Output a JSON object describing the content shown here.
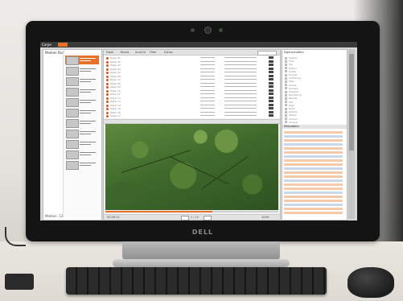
{
  "monitor": {
    "brand": "DELL"
  },
  "app": {
    "title": "Carpe",
    "badge_color": "#e8712a"
  },
  "left_panel": {
    "header": "Medien Pool",
    "footer": "Medien: 12",
    "thumbnails": [
      {
        "selected": true
      },
      {
        "selected": false
      },
      {
        "selected": false
      },
      {
        "selected": false
      },
      {
        "selected": false
      },
      {
        "selected": false
      },
      {
        "selected": false
      },
      {
        "selected": false
      },
      {
        "selected": false
      },
      {
        "selected": false
      },
      {
        "selected": false
      }
    ]
  },
  "center": {
    "toolbar": [
      "Datei",
      "Bearb.",
      "Ansicht",
      "Filter",
      "Extras"
    ],
    "rows": [
      "Datei 01",
      "Datei 02",
      "Datei 03",
      "Datei 04",
      "Datei 05",
      "Datei 06",
      "Datei 07",
      "Datei 08",
      "Datei 09",
      "Datei 10",
      "Datei 11",
      "Datei 12",
      "Datei 13",
      "Datei 14",
      "Datei 15",
      "Datei 16",
      "Datei 17"
    ],
    "preview_progress": 0.62,
    "footer": {
      "left": "00:00:12",
      "mid": "1 / 12",
      "right": "100%"
    }
  },
  "right_panel": {
    "header": "Eigenschaften",
    "lines": [
      "Objekt",
      "Titel",
      "Typ",
      "Datum",
      "Größe",
      "Format",
      "Auflösung",
      "Pfad",
      "Quelle",
      "Kamera",
      "Objektiv",
      "Belichtung",
      "Blende",
      "ISO",
      "Tags",
      "Notiz",
      "Rechte",
      "Status",
      "Version",
      "Verlauf"
    ],
    "section_title": "Metadaten",
    "fields": [
      "orange",
      "blue",
      "orange",
      "blue",
      "orange",
      "orange",
      "blue",
      "orange",
      "orange",
      "blue",
      "orange",
      "orange",
      "blue",
      "orange",
      "orange",
      "blue",
      "orange",
      "orange",
      "blue",
      "orange",
      "orange"
    ]
  }
}
